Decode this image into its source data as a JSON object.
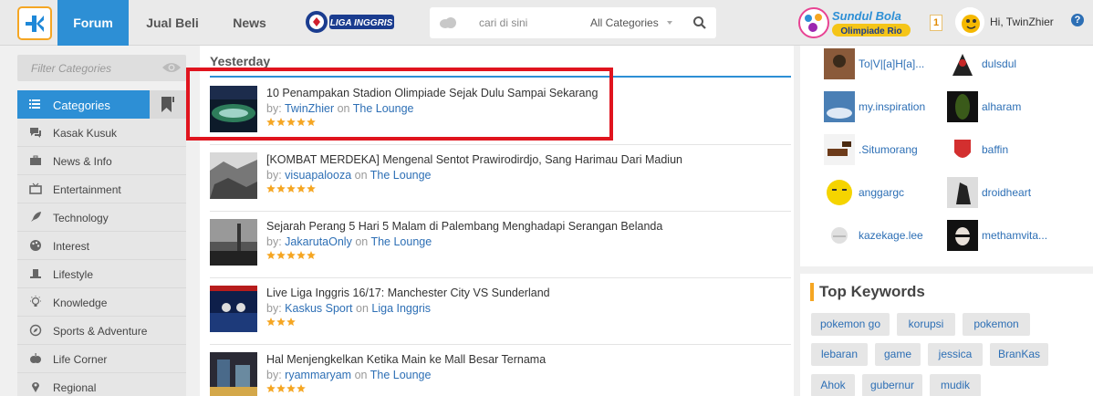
{
  "header": {
    "nav": [
      "Forum",
      "Jual Beli",
      "News"
    ],
    "liga_logo_text": "LIGA INGGRIS",
    "search": {
      "placeholder": "cari di sini",
      "category": "All Categories"
    },
    "promo": {
      "line1": "Sundul Bola",
      "line2": "Olimpiade Rio"
    },
    "notification_count": "1",
    "greeting": "Hi, TwinZhier",
    "help": "?"
  },
  "sidebar": {
    "filter_placeholder": "Filter Categories",
    "header_label": "Categories",
    "items": [
      {
        "label": "Kasak Kusuk",
        "icon": "chat-icon"
      },
      {
        "label": "News & Info",
        "icon": "briefcase-icon"
      },
      {
        "label": "Entertainment",
        "icon": "tv-icon"
      },
      {
        "label": "Technology",
        "icon": "rocket-icon"
      },
      {
        "label": "Interest",
        "icon": "palette-icon"
      },
      {
        "label": "Lifestyle",
        "icon": "hat-icon"
      },
      {
        "label": "Knowledge",
        "icon": "bulb-icon"
      },
      {
        "label": "Sports & Adventure",
        "icon": "compass-icon"
      },
      {
        "label": "Life Corner",
        "icon": "apple-icon"
      },
      {
        "label": "Regional",
        "icon": "pin-icon"
      }
    ]
  },
  "main": {
    "section_title": "Yesterday",
    "threads": [
      {
        "title": "10 Penampakan Stadion Olimpiade Sejak Dulu Sampai Sekarang",
        "by": "by:",
        "author": "TwinZhier",
        "on": "on",
        "forum": "The Lounge",
        "rating": 5
      },
      {
        "title": "[KOMBAT MERDEKA] Mengenal Sentot Prawirodirdjo, Sang Harimau Dari Madiun",
        "by": "by:",
        "author": "visuapalooza",
        "on": "on",
        "forum": "The Lounge",
        "rating": 5
      },
      {
        "title": "Sejarah Perang 5 Hari 5 Malam di Palembang Menghadapi Serangan Belanda",
        "by": "by:",
        "author": "JakarutaOnly",
        "on": "on",
        "forum": "The Lounge",
        "rating": 5
      },
      {
        "title": "Live Liga Inggris 16/17: Manchester City VS Sunderland",
        "by": "by:",
        "author": "Kaskus Sport",
        "on": "on",
        "forum": "Liga Inggris",
        "rating": 3
      },
      {
        "title": "Hal Menjengkelkan Ketika Main ke Mall Besar Ternama",
        "by": "by:",
        "author": "ryammaryam",
        "on": "on",
        "forum": "The Lounge",
        "rating": 4
      }
    ]
  },
  "right": {
    "users": [
      {
        "name": "To|V|[a]H[a]..."
      },
      {
        "name": "dulsdul"
      },
      {
        "name": "my.inspiration"
      },
      {
        "name": "alharam"
      },
      {
        "name": ".Situmorang"
      },
      {
        "name": "baffin"
      },
      {
        "name": "anggargc"
      },
      {
        "name": "droidheart"
      },
      {
        "name": "kazekage.lee"
      },
      {
        "name": "methamvita..."
      }
    ],
    "keywords_title": "Top Keywords",
    "keywords": [
      "pokemon go",
      "korupsi",
      "pokemon",
      "lebaran",
      "game",
      "jessica",
      "BranKas",
      "Ahok",
      "gubernur",
      "mudik"
    ]
  },
  "colors": {
    "accent": "#2d8fd5",
    "star": "#f5a623",
    "highlight": "#e0141e",
    "link": "#2d6fb5"
  }
}
